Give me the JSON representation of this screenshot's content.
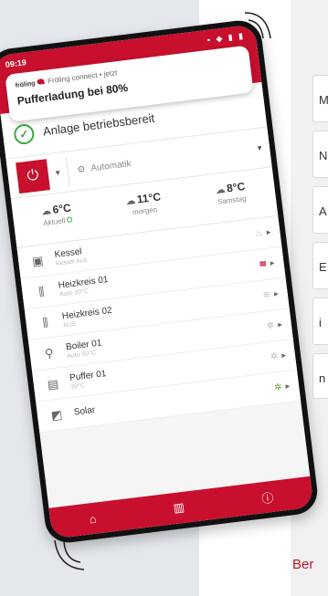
{
  "side_cards": [
    "M",
    "N",
    "A",
    "E",
    "i",
    "n"
  ],
  "side_link": "Ber",
  "phone": {
    "status_time": "09:19",
    "status_icons": "▪ ◆ ▮ ▮",
    "notification": {
      "app_logo": "fröling",
      "app_logo_sub": "connect",
      "meta": "Fröling connect • jetzt",
      "title": "Pufferladung bei 80%"
    },
    "system_status": "Anlage betriebsbereit",
    "power_symbol": "⏻",
    "mode_label": "Automatik",
    "weather": [
      {
        "temp": "6°C",
        "label": "Aktuell"
      },
      {
        "temp": "11°C",
        "label": "morgen"
      },
      {
        "temp": "8°C",
        "label": "Samstag"
      }
    ],
    "devices": [
      {
        "icon": "boiler-icon",
        "glyph": "▣",
        "name": "Kessel",
        "sub": "Kessel Aus",
        "state_glyph": "♨",
        "state_class": ""
      },
      {
        "icon": "heating-circuit-icon",
        "glyph": "⫼",
        "name": "Heizkreis 01",
        "sub": "Auto 20°C",
        "state_glyph": "≋",
        "state_class": "active"
      },
      {
        "icon": "heating-circuit-icon",
        "glyph": "⫼",
        "name": "Heizkreis 02",
        "sub": "AUS",
        "state_glyph": "≋",
        "state_class": ""
      },
      {
        "icon": "hot-water-tap-icon",
        "glyph": "⚲",
        "name": "Boiler 01",
        "sub": "Auto 50°C",
        "state_glyph": "✲",
        "state_class": ""
      },
      {
        "icon": "buffer-tank-icon",
        "glyph": "▤",
        "name": "Puffer 01",
        "sub": "39°C",
        "state_glyph": "✲",
        "state_class": ""
      },
      {
        "icon": "solar-icon",
        "glyph": "◩",
        "name": "Solar",
        "sub": "",
        "state_glyph": "✲",
        "state_class": "green"
      }
    ],
    "nav": {
      "home": "⌂",
      "system": "▥",
      "info": "ⓘ"
    }
  }
}
